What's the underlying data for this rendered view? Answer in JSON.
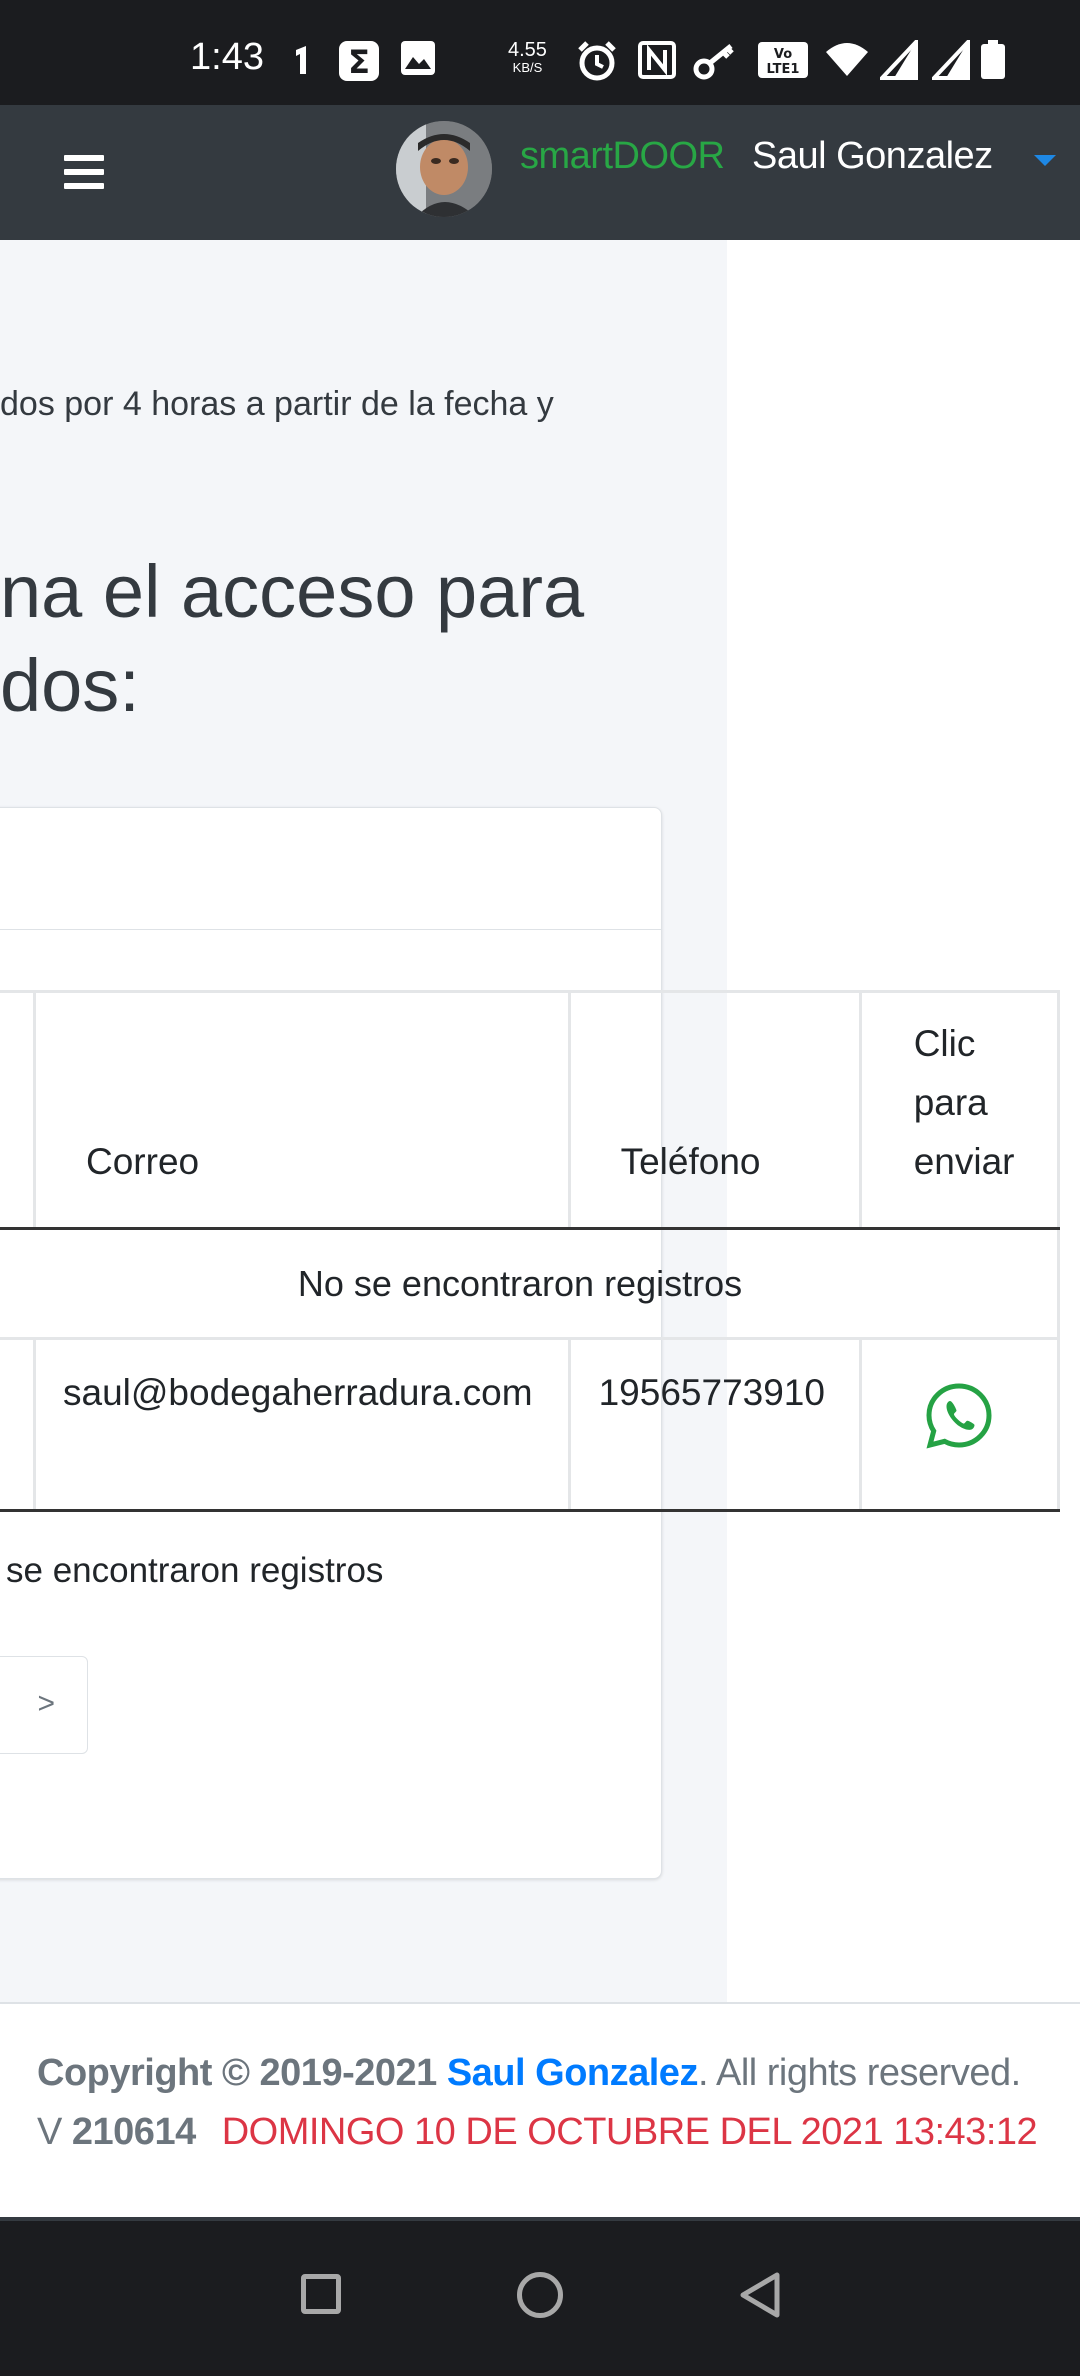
{
  "status_bar": {
    "time": "1:43",
    "speed_value": "4.55",
    "speed_unit": "KB/S",
    "icons": [
      "sigma-icon",
      "image-icon",
      "alarm-icon",
      "nfc-icon",
      "key-icon",
      "volte-icon",
      "wifi-icon",
      "signal-icon",
      "signal-icon-2",
      "battery-icon"
    ]
  },
  "navbar": {
    "brand": "smartDOOR",
    "user_name": "Saul Gonzalez",
    "menu_icon": "hamburger-icon",
    "dropdown_icon": "caret-down-icon"
  },
  "content": {
    "intro_text": "dos por 4 horas a partir de la fecha y",
    "heading_line1": "na el acceso para",
    "heading_line2": "dos:",
    "table": {
      "headers": {
        "correo": "Correo",
        "telefono": "Teléfono",
        "clic": "Clic para enviar"
      },
      "empty_row_text": "No se encontraron registros",
      "rows": [
        {
          "email": "saul@bodegaherradura.com",
          "phone": "19565773910",
          "action_icon": "whatsapp-icon"
        }
      ]
    },
    "footer_text": "se encontraron registros",
    "pagination_next": ">"
  },
  "footer": {
    "copyright_prefix": "Copyright © 2019-2021 ",
    "author": "Saul Gonzalez",
    "copyright_suffix": ". All rights reserved.",
    "version_label": "V ",
    "version": "210614",
    "datetime": "DOMINGO 10 DE OCTUBRE DEL 2021 13:43:12"
  },
  "colors": {
    "brand": "#28a745",
    "navbar_bg": "#343a40",
    "link": "#007bff",
    "datetime": "#dc3545",
    "whatsapp": "#25a244"
  }
}
